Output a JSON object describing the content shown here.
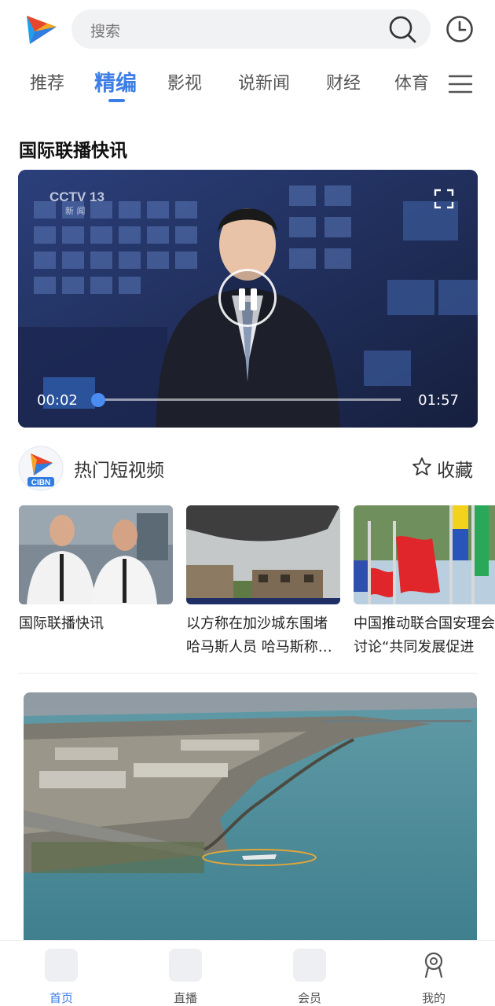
{
  "search": {
    "placeholder": "搜索"
  },
  "tabs": [
    {
      "label": "推荐",
      "active": false
    },
    {
      "label": "精编",
      "active": true
    },
    {
      "label": "影视",
      "active": false
    },
    {
      "label": "说新闻",
      "active": false
    },
    {
      "label": "财经",
      "active": false
    },
    {
      "label": "体育",
      "active": false
    }
  ],
  "section": {
    "title": "国际联播快讯"
  },
  "player": {
    "watermark_left": "CCTV 13 新闻",
    "current_time": "00:02",
    "total_time": "01:57",
    "progress_fraction": 0.017
  },
  "hot": {
    "channel_badge": "CIBN",
    "title": "热门短视频",
    "favorite_label": "收藏"
  },
  "shorts": [
    {
      "title": "国际联播快讯"
    },
    {
      "title": "以方称在加沙城东围堵哈马斯人员 哈马斯称…"
    },
    {
      "title": "中国推动联合国安理会讨论“共同发展促进"
    }
  ],
  "bottom_nav": [
    {
      "label": "首页",
      "active": true
    },
    {
      "label": "直播",
      "active": false
    },
    {
      "label": "会员",
      "active": false
    },
    {
      "label": "我的",
      "active": false
    }
  ],
  "colors": {
    "accent": "#3d7ee6"
  }
}
